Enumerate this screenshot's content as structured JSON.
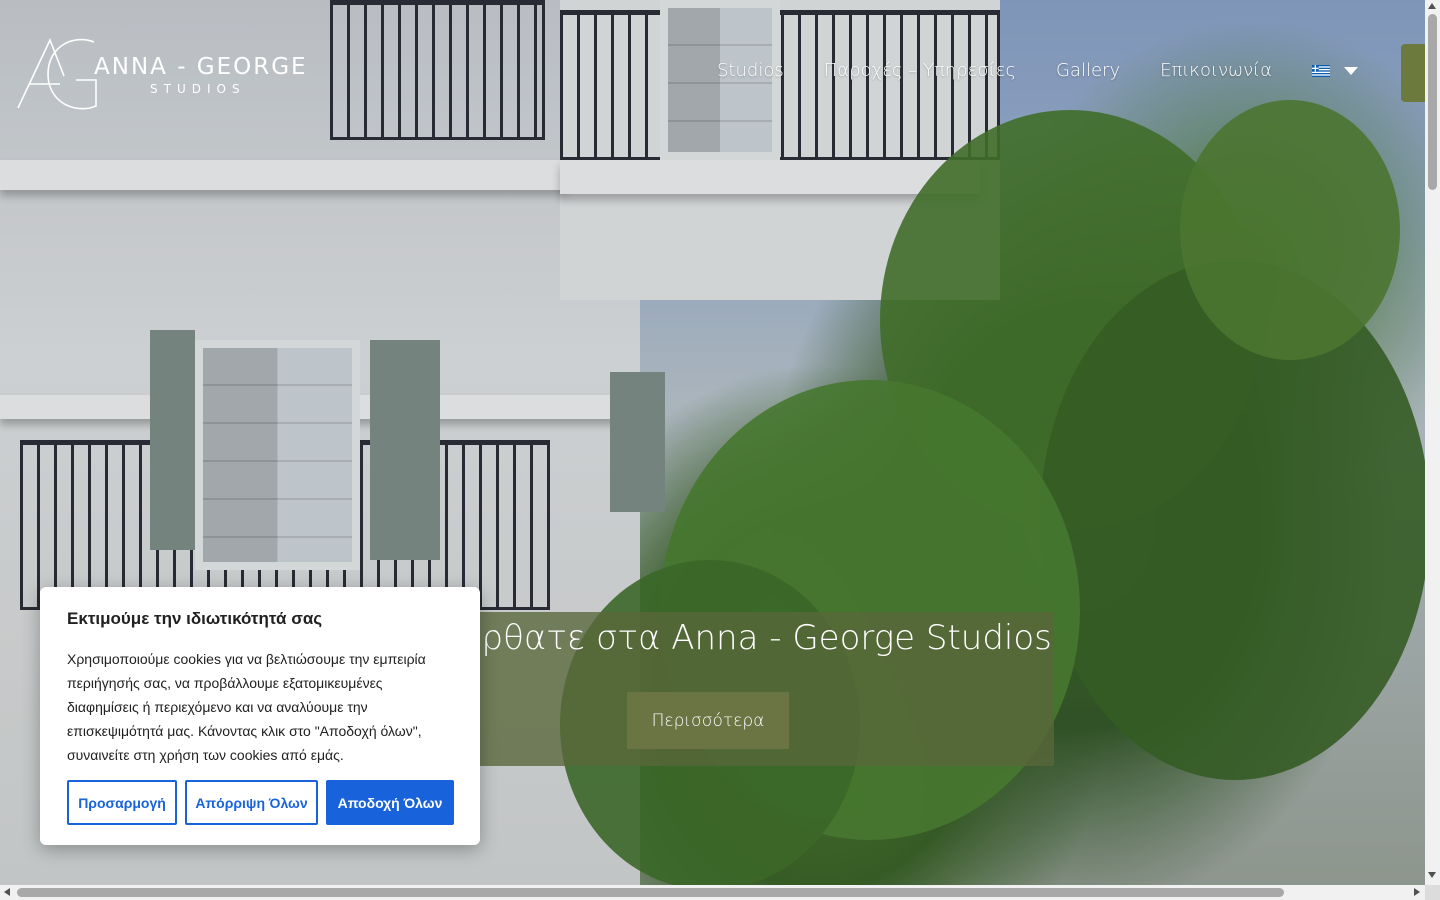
{
  "header": {
    "logo": {
      "monogram": "AG",
      "name": "ANNA - GEORGE",
      "subtitle": "STUDIOS"
    },
    "nav": [
      {
        "label": "Studios"
      },
      {
        "label": "Παροχές – Υπηρεσίες"
      },
      {
        "label": "Gallery"
      },
      {
        "label": "Επικοινωνία"
      }
    ],
    "language": {
      "flag_icon": "greek-flag-icon",
      "dropdown_icon": "caret-down-icon"
    }
  },
  "hero": {
    "title": "ήρθατε στα Anna - George Studios",
    "button_label": "Περισσότερα"
  },
  "cookie_banner": {
    "title": "Εκτιμούμε την ιδιωτικότητά σας",
    "text": "Χρησιμοποιούμε cookies για να βελτιώσουμε την εμπειρία περιήγησής σας, να προβάλλουμε εξατομικευμένες διαφημίσεις ή περιεχόμενο και να αναλύουμε την επισκεψιμότητά μας. Κάνοντας κλικ στο \"Αποδοχή όλων\", συναινείτε στη χρήση των cookies από εμάς.",
    "buttons": {
      "customize": "Προσαρμογή",
      "reject": "Απόρριψη Όλων",
      "accept": "Αποδοχή Όλων"
    }
  },
  "colors": {
    "accent_green": "#6b7543",
    "caption_overlay": "#58673a",
    "cookie_blue": "#1863dc"
  }
}
